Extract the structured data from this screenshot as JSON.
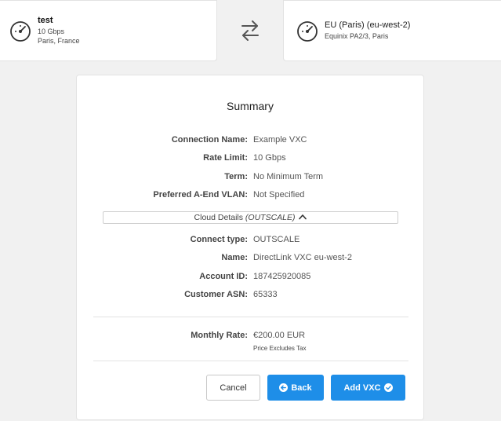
{
  "a_end": {
    "title": "test",
    "speed": "10 Gbps",
    "location": "Paris, France",
    "icon": "speedometer-icon"
  },
  "swap_icon": "swap-arrows-icon",
  "b_end": {
    "title": "EU (Paris) (eu-west-2)",
    "location": "Equinix PA2/3, Paris",
    "icon": "speedometer-icon"
  },
  "summary": {
    "title": "Summary",
    "rows": [
      {
        "label": "Connection Name:",
        "value": "Example VXC"
      },
      {
        "label": "Rate Limit:",
        "value": "10 Gbps"
      },
      {
        "label": "Term:",
        "value": "No Minimum Term"
      },
      {
        "label": "Preferred A-End VLAN:",
        "value": "Not Specified"
      }
    ],
    "cloud_details": {
      "label": "Cloud Details",
      "provider": "(OUTSCALE)",
      "icon": "chevron-up-icon"
    },
    "cloud_rows": [
      {
        "label": "Connect type:",
        "value": "OUTSCALE"
      },
      {
        "label": "Name:",
        "value": "DirectLink VXC eu-west-2"
      },
      {
        "label": "Account ID:",
        "value": "187425920085"
      },
      {
        "label": "Customer ASN:",
        "value": "65333"
      }
    ],
    "monthly_rate": {
      "label": "Monthly Rate:",
      "value": "€200.00 EUR",
      "note": "Price Excludes Tax"
    }
  },
  "actions": {
    "cancel": "Cancel",
    "back": "Back",
    "back_icon": "arrow-left-circle-icon",
    "add": "Add VXC",
    "add_icon": "check-circle-icon"
  },
  "colors": {
    "primary": "#1e8ee8",
    "background": "#f1f1f1"
  }
}
